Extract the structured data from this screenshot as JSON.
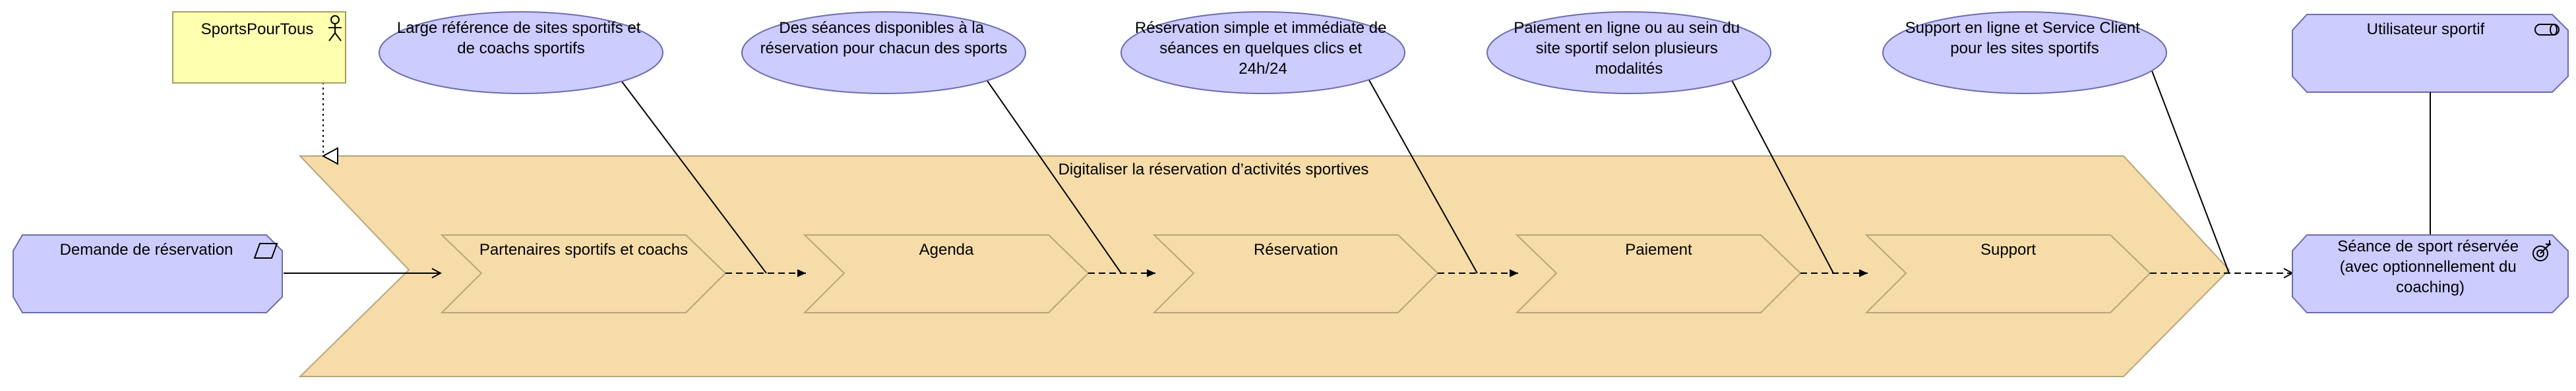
{
  "colors": {
    "stream_fill": "#F5DCA8",
    "stream_stroke": "#B8A57A",
    "blue_fill": "#CCCCFF",
    "blue_stroke": "#6B6BB0",
    "actor_fill": "#FFFFB0",
    "actor_stroke": "#A0A060"
  },
  "value_stream": {
    "title": "Digitaliser la réservation d’activités sportives"
  },
  "stages": [
    {
      "label": "Partenaires sportifs et coachs"
    },
    {
      "label": "Agenda"
    },
    {
      "label": "Réservation"
    },
    {
      "label": "Paiement"
    },
    {
      "label": "Support"
    }
  ],
  "notes": [
    {
      "lines": [
        "Large référence de sites sportifs et",
        "de coachs sportifs"
      ]
    },
    {
      "lines": [
        "Des séances disponibles à la",
        "réservation pour chacun des sports"
      ]
    },
    {
      "lines": [
        "Réservation simple et immédiate de",
        "séances en quelques clics et",
        "24h/24"
      ]
    },
    {
      "lines": [
        "Paiement en ligne ou au sein du",
        "site sportif selon plusieurs",
        "modalités"
      ]
    },
    {
      "lines": [
        "Support en ligne et Service Client",
        "pour les sites sportifs"
      ]
    }
  ],
  "actor": {
    "label": "SportsPourTous",
    "icon": "actor-icon"
  },
  "event": {
    "label": "Demande de réservation",
    "icon": "event-parallelogram-icon"
  },
  "outcome": {
    "lines": [
      "Séance de sport réservée",
      "(avec optionnellement du",
      "coaching)"
    ],
    "icon": "target-icon"
  },
  "role": {
    "label": "Utilisateur sportif",
    "icon": "role-icon"
  }
}
